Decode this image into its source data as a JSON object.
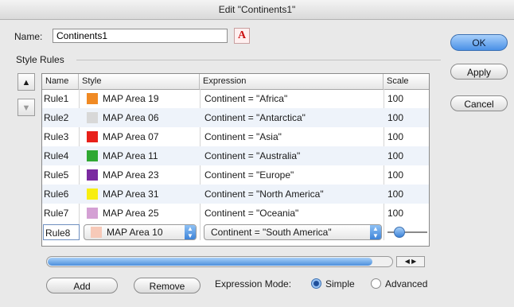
{
  "window": {
    "title": "Edit \"Continents1\""
  },
  "name_field": {
    "label": "Name:",
    "value": "Continents1"
  },
  "font_icon": {
    "glyph": "A",
    "name": "font-icon"
  },
  "section": {
    "label": "Style Rules"
  },
  "buttons": {
    "ok": "OK",
    "apply": "Apply",
    "cancel": "Cancel",
    "add": "Add",
    "remove": "Remove"
  },
  "move_buttons": {
    "up": "▲",
    "down": "▼"
  },
  "table": {
    "headers": {
      "name": "Name",
      "style": "Style",
      "expression": "Expression",
      "scale": "Scale"
    },
    "rows": [
      {
        "name": "Rule1",
        "style": "MAP Area 19",
        "color": "#f08a24",
        "expression": "Continent = \"Africa\"",
        "scale": "100"
      },
      {
        "name": "Rule2",
        "style": "MAP Area 06",
        "color": "#d8d8d8",
        "expression": "Continent = \"Antarctica\"",
        "scale": "100"
      },
      {
        "name": "Rule3",
        "style": "MAP Area 07",
        "color": "#e8201a",
        "expression": "Continent = \"Asia\"",
        "scale": "100"
      },
      {
        "name": "Rule4",
        "style": "MAP Area 11",
        "color": "#2fa832",
        "expression": "Continent = \"Australia\"",
        "scale": "100"
      },
      {
        "name": "Rule5",
        "style": "MAP Area 23",
        "color": "#7a2aa0",
        "expression": "Continent = \"Europe\"",
        "scale": "100"
      },
      {
        "name": "Rule6",
        "style": "MAP Area 31",
        "color": "#f8ee10",
        "expression": "Continent = \"North America\"",
        "scale": "100"
      },
      {
        "name": "Rule7",
        "style": "MAP Area 25",
        "color": "#d4a0d4",
        "expression": "Continent = \"Oceania\"",
        "scale": "100"
      }
    ],
    "edit_row": {
      "name": "Rule8",
      "style": "MAP Area 10",
      "color": "#f7c9b8",
      "expression": "Continent = \"South America\""
    }
  },
  "expression_mode": {
    "label": "Expression Mode:",
    "simple": "Simple",
    "advanced": "Advanced",
    "selected": "Simple"
  }
}
